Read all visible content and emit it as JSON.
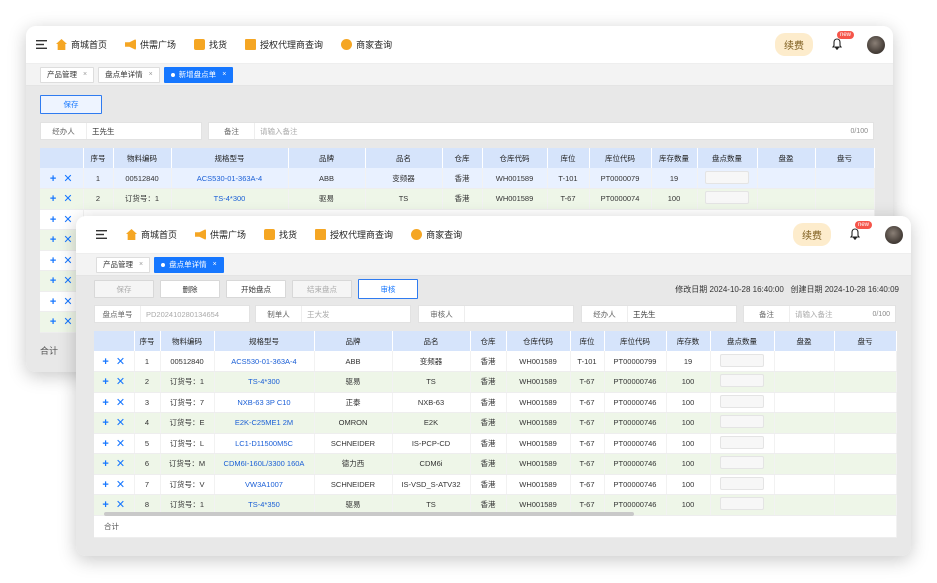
{
  "nav": {
    "items": [
      {
        "label": "商城首页",
        "icon": "home-icon"
      },
      {
        "label": "供需广场",
        "icon": "megaphone-icon"
      },
      {
        "label": "找货",
        "icon": "search-goods-icon"
      },
      {
        "label": "授权代理商查询",
        "icon": "agent-icon"
      },
      {
        "label": "商家查询",
        "icon": "shop-icon"
      }
    ],
    "renew_label": "续费",
    "new_badge": "new"
  },
  "back_window": {
    "tabs": [
      {
        "label": "产品管理",
        "close": "×"
      },
      {
        "label": "盘点单详情",
        "close": "×"
      },
      {
        "label": "新增盘点单",
        "close": "×",
        "active": true
      }
    ],
    "save_label": "保存",
    "handler_label": "经办人",
    "handler_value": "王先生",
    "remark_label": "备注",
    "remark_placeholder": "请输入备注",
    "remark_count": "0/100",
    "columns": [
      "序号",
      "物料编码",
      "规格型号",
      "品牌",
      "品名",
      "仓库",
      "仓库代码",
      "库位",
      "库位代码",
      "库存数量",
      "盘点数量",
      "盘盈",
      "盘亏"
    ],
    "rows": [
      [
        "1",
        "00512840",
        "ACS530-01-363A-4",
        "ABB",
        "变频器",
        "香港",
        "WH001589",
        "T-101",
        "PT0000079",
        "19"
      ],
      [
        "2",
        "订货号：1",
        "TS-4*300",
        "驱易",
        "TS",
        "香港",
        "WH001589",
        "T-67",
        "PT0000074",
        "100"
      ]
    ],
    "total_label": "合计"
  },
  "front_window": {
    "tabs": [
      {
        "label": "产品管理",
        "close": "×"
      },
      {
        "label": "盘点单详情",
        "close": "×",
        "active": true
      }
    ],
    "buttons": {
      "save": "保存",
      "delete": "删除",
      "start": "开始盘点",
      "finish": "结束盘点",
      "audit": "审核"
    },
    "modified_label": "修改日期",
    "modified_value": "2024-10-28 16:40:00",
    "created_label": "创建日期",
    "created_value": "2024-10-28 16:40:09",
    "form": {
      "order_no_label": "盘点单号",
      "order_no_value": "PD202410280134654",
      "creator_label": "制单人",
      "creator_value": "王大发",
      "auditor_label": "审核人",
      "auditor_value": "",
      "handler_label": "经办人",
      "handler_value": "王先生",
      "remark_label": "备注",
      "remark_placeholder": "请输入备注",
      "remark_count": "0/100"
    },
    "columns": [
      "序号",
      "物料编码",
      "规格型号",
      "品牌",
      "品名",
      "仓库",
      "仓库代码",
      "库位",
      "库位代码",
      "库存数",
      "盘点数量",
      "盘盈",
      "盘亏"
    ],
    "rows": [
      [
        "1",
        "00512840",
        "ACS530-01-363A-4",
        "ABB",
        "变频器",
        "香港",
        "WH001589",
        "T-101",
        "PT00000799",
        "19"
      ],
      [
        "2",
        "订货号：1",
        "TS-4*300",
        "驱易",
        "TS",
        "香港",
        "WH001589",
        "T-67",
        "PT00000746",
        "100"
      ],
      [
        "3",
        "订货号：7",
        "NXB-63 3P C10",
        "正泰",
        "NXB-63",
        "香港",
        "WH001589",
        "T-67",
        "PT00000746",
        "100"
      ],
      [
        "4",
        "订货号：E",
        "E2K-C25ME1 2M",
        "OMRON",
        "E2K",
        "香港",
        "WH001589",
        "T-67",
        "PT00000746",
        "100"
      ],
      [
        "5",
        "订货号：L",
        "LC1-D11500M5C",
        "SCHNEIDER",
        "IS-PCP-CD",
        "香港",
        "WH001589",
        "T-67",
        "PT00000746",
        "100"
      ],
      [
        "6",
        "订货号：M",
        "CDM6I-160L/3300 160A",
        "德力西",
        "CDM6i",
        "香港",
        "WH001589",
        "T-67",
        "PT00000746",
        "100"
      ],
      [
        "7",
        "订货号：V",
        "VW3A1007",
        "SCHNEIDER",
        "IS-VSD_S-ATV32",
        "香港",
        "WH001589",
        "T-67",
        "PT00000746",
        "100"
      ],
      [
        "8",
        "订货号：1",
        "TS-4*350",
        "驱易",
        "TS",
        "香港",
        "WH001589",
        "T-67",
        "PT00000746",
        "100"
      ]
    ],
    "total_label": "合计"
  }
}
